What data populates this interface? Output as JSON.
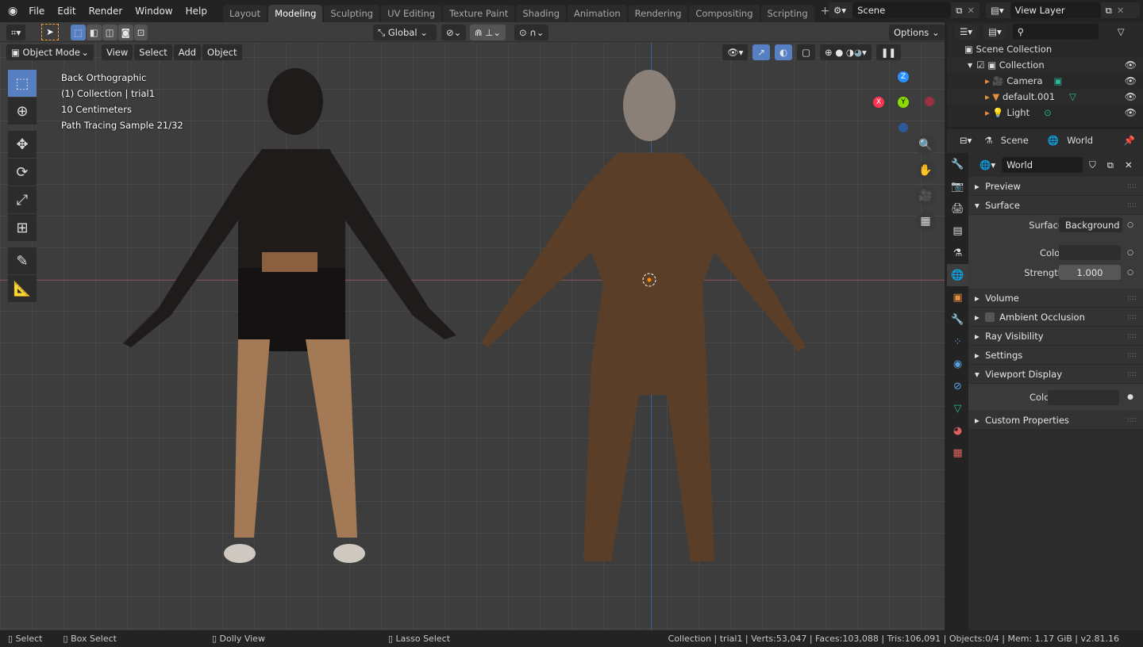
{
  "topbar": {
    "menus": [
      "File",
      "Edit",
      "Render",
      "Window",
      "Help"
    ],
    "workspaces": [
      "Layout",
      "Modeling",
      "Sculpting",
      "UV Editing",
      "Texture Paint",
      "Shading",
      "Animation",
      "Rendering",
      "Compositing",
      "Scripting"
    ],
    "active_workspace": "Modeling",
    "scene": "Scene",
    "view_layer": "View Layer"
  },
  "toolheader": {
    "orientation": "Global",
    "options": "Options"
  },
  "viewport": {
    "mode": "Object Mode",
    "menus": [
      "View",
      "Select",
      "Add",
      "Object"
    ],
    "overlay_text": [
      "Back Orthographic",
      "(1) Collection | trial1",
      "10 Centimeters",
      "Path Tracing Sample 21/32"
    ],
    "gizmo": {
      "x": "X",
      "y": "Y",
      "z": "Z"
    },
    "colors": {
      "x": "#ff3352",
      "y": "#8bdc00",
      "z": "#2890ff"
    }
  },
  "outliner": {
    "root": "Scene Collection",
    "collection": "Collection",
    "items": [
      {
        "name": "Camera",
        "icon": "camera-icon"
      },
      {
        "name": "default.001",
        "icon": "mesh-icon"
      },
      {
        "name": "Light",
        "icon": "light-icon"
      }
    ]
  },
  "properties": {
    "breadcrumb": [
      "Scene",
      "World"
    ],
    "world_name": "World",
    "panels": {
      "preview": "Preview",
      "surface": "Surface",
      "volume": "Volume",
      "ao": "Ambient Occlusion",
      "ray": "Ray Visibility",
      "settings": "Settings",
      "viewport_display": "Viewport Display",
      "custom": "Custom Properties"
    },
    "surface_label": "Surface",
    "surface_value": "Background",
    "color_label": "Color",
    "strength_label": "Strength",
    "strength_value": "1.000",
    "vd_color_label": "Color"
  },
  "status": {
    "select": "Select",
    "box_select": "Box Select",
    "dolly": "Dolly View",
    "lasso": "Lasso Select",
    "info": "Collection | trial1 | Verts:53,047 | Faces:103,088 | Tris:106,091 | Objects:0/4 | Mem: 1.17 GiB | v2.81.16"
  }
}
